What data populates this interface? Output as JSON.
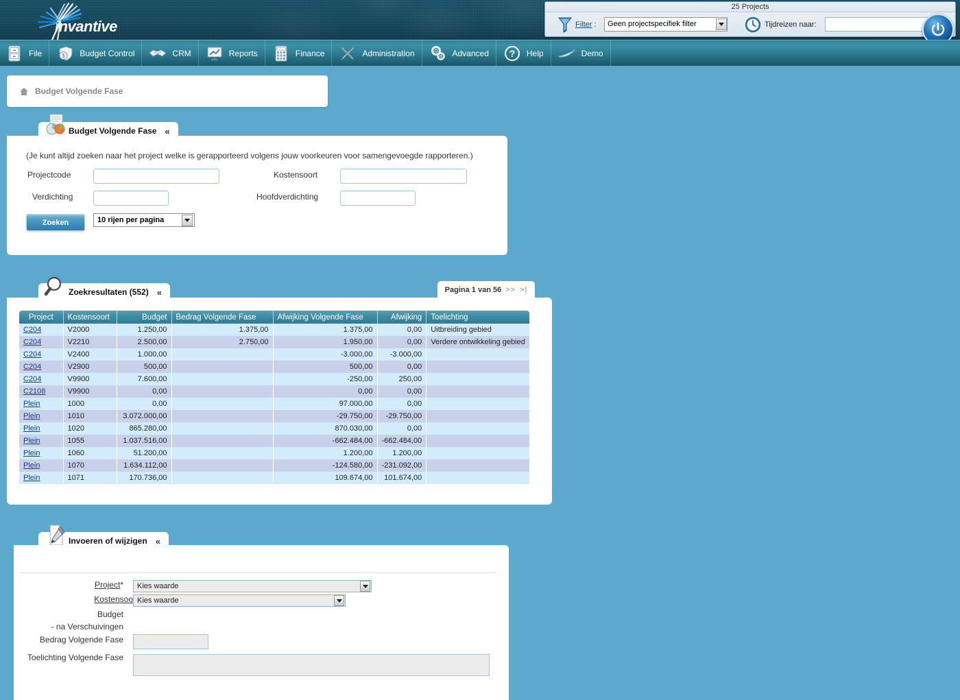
{
  "banner": {
    "logo_text": "invantive",
    "logo_icon": "starburst-logo-icon"
  },
  "topfilter": {
    "title": "25 Projects",
    "filter_icon": "funnel-icon",
    "filter_label": "Filter",
    "filter_colon": " :",
    "filter_value": "Geen projectspecifiek filter",
    "clock_icon": "time-travel-clock-icon",
    "timetravel_label": "Tijdreizen naar:",
    "timetravel_value": "",
    "timetravel_placeholder": "",
    "power_icon": "power-button-icon"
  },
  "menu": {
    "items": [
      {
        "label": "File",
        "icon": "file-cabinet-icon"
      },
      {
        "label": "Budget Control",
        "icon": "money-bag-shield-icon"
      },
      {
        "label": "CRM",
        "icon": "handshake-icon"
      },
      {
        "label": "Reports",
        "icon": "presentation-chart-icon"
      },
      {
        "label": "Finance",
        "icon": "calculator-icon"
      },
      {
        "label": "Administration",
        "icon": "tools-wrench-icon"
      },
      {
        "label": "Advanced",
        "icon": "gears-icon"
      },
      {
        "label": "Help",
        "icon": "question-mark-icon"
      },
      {
        "label": "Demo",
        "icon": "swoosh-icon"
      }
    ]
  },
  "breadcrumb": {
    "home_icon": "home-icon",
    "text": "Budget Volgende Fase"
  },
  "search_panel": {
    "tab_title": "Budget Volgende Fase",
    "tab_icon": "report-pie-clock-icon",
    "collapse_icon": "chevron-up-icon",
    "hint": "(Je kunt altijd zoeken naar het project welke is gerapporteerd volgens jouw voorkeuren voor samengevoegde rapporteren.)",
    "fields": {
      "projectcode_label": "Projectcode",
      "projectcode_value": "",
      "kostensoort_label": "Kostensoort",
      "kostensoort_value": "",
      "verdichting_label": "Verdichting",
      "verdichting_value": "",
      "hoofdverdichting_label": "Hoofdverdichting",
      "hoofdverdichting_value": ""
    },
    "search_button": "Zoeken",
    "rows_per_page": "10 rijen per pagina"
  },
  "results_panel": {
    "tab_title": "Zoekresultaten (552)",
    "tab_icon": "magnifier-icon",
    "collapse_icon": "chevron-up-icon",
    "pager_text": "Pagina 1 van 56",
    "pager_next": ">>",
    "pager_last": ">|",
    "columns": [
      "Project",
      "Kostensoort",
      "Budget",
      "Bedrag Volgende Fase",
      "Afwijking Volgende Fase",
      "Afwijking",
      "Toelichting"
    ],
    "rows": [
      {
        "project": "C204",
        "kostensoort": "V2000",
        "budget": "1.250,00",
        "bedrag": "1.375,00",
        "afwijking_vf": "1.375,00",
        "afwijking": "0,00",
        "toelichting": "Uitbreiding gebied"
      },
      {
        "project": "C204",
        "kostensoort": "V2210",
        "budget": "2.500,00",
        "bedrag": "2.750,00",
        "afwijking_vf": "1.950,00",
        "afwijking": "0,00",
        "toelichting": "Verdere ontwikkeling gebied"
      },
      {
        "project": "C204",
        "kostensoort": "V2400",
        "budget": "1.000,00",
        "bedrag": "",
        "afwijking_vf": "-3.000,00",
        "afwijking": "-3.000,00",
        "toelichting": ""
      },
      {
        "project": "C204",
        "kostensoort": "V2900",
        "budget": "500,00",
        "bedrag": "",
        "afwijking_vf": "500,00",
        "afwijking": "0,00",
        "toelichting": ""
      },
      {
        "project": "C204",
        "kostensoort": "V9900",
        "budget": "7.600,00",
        "bedrag": "",
        "afwijking_vf": "-250,00",
        "afwijking": "250,00",
        "toelichting": ""
      },
      {
        "project": "C2108",
        "kostensoort": "V9900",
        "budget": "0,00",
        "bedrag": "",
        "afwijking_vf": "0,00",
        "afwijking": "0,00",
        "toelichting": ""
      },
      {
        "project": "Plein",
        "kostensoort": "1000",
        "budget": "0,00",
        "bedrag": "",
        "afwijking_vf": "97.000,00",
        "afwijking": "0,00",
        "toelichting": ""
      },
      {
        "project": "Plein",
        "kostensoort": "1010",
        "budget": "3.072.000,00",
        "bedrag": "",
        "afwijking_vf": "-29.750,00",
        "afwijking": "-29.750,00",
        "toelichting": ""
      },
      {
        "project": "Plein",
        "kostensoort": "1020",
        "budget": "865.280,00",
        "bedrag": "",
        "afwijking_vf": "870.030,00",
        "afwijking": "0,00",
        "toelichting": ""
      },
      {
        "project": "Plein",
        "kostensoort": "1055",
        "budget": "1.037.516,00",
        "bedrag": "",
        "afwijking_vf": "-662.484,00",
        "afwijking": "-662.484,00",
        "toelichting": ""
      },
      {
        "project": "Plein",
        "kostensoort": "1060",
        "budget": "51.200,00",
        "bedrag": "",
        "afwijking_vf": "1.200,00",
        "afwijking": "1.200,00",
        "toelichting": ""
      },
      {
        "project": "Plein",
        "kostensoort": "1070",
        "budget": "1.634.112,00",
        "bedrag": "",
        "afwijking_vf": "-124.580,00",
        "afwijking": "-231.092,00",
        "toelichting": ""
      },
      {
        "project": "Plein",
        "kostensoort": "1071",
        "budget": "170.736,00",
        "bedrag": "",
        "afwijking_vf": "109.674,00",
        "afwijking": "101.674,00",
        "toelichting": ""
      }
    ]
  },
  "edit_panel": {
    "tab_title": "Invoeren of wijzigen",
    "tab_icon": "pencil-document-icon",
    "collapse_icon": "chevron-up-icon",
    "project_label": "Project",
    "project_required": "*",
    "project_value": "Kies waarde",
    "kostensoort_label": "Kostensoort",
    "kostensoort_required": "*",
    "kostensoort_value": "Kies waarde",
    "budget_label": "Budget",
    "na_verschuivingen_label": "- na Verschuivingen",
    "bedrag_label": "Bedrag Volgende Fase",
    "bedrag_value": "",
    "toelichting_label": "Toelichting Volgende Fase",
    "toelichting_value": ""
  },
  "colors": {
    "page_background": "#5da8cd",
    "banner": "#17485c",
    "menubar": "#2d7c92",
    "table_header": "#3f8ca4",
    "row_odd": "#d3ecfb",
    "row_even": "#c8d1e9",
    "link": "#1a3c8c"
  }
}
